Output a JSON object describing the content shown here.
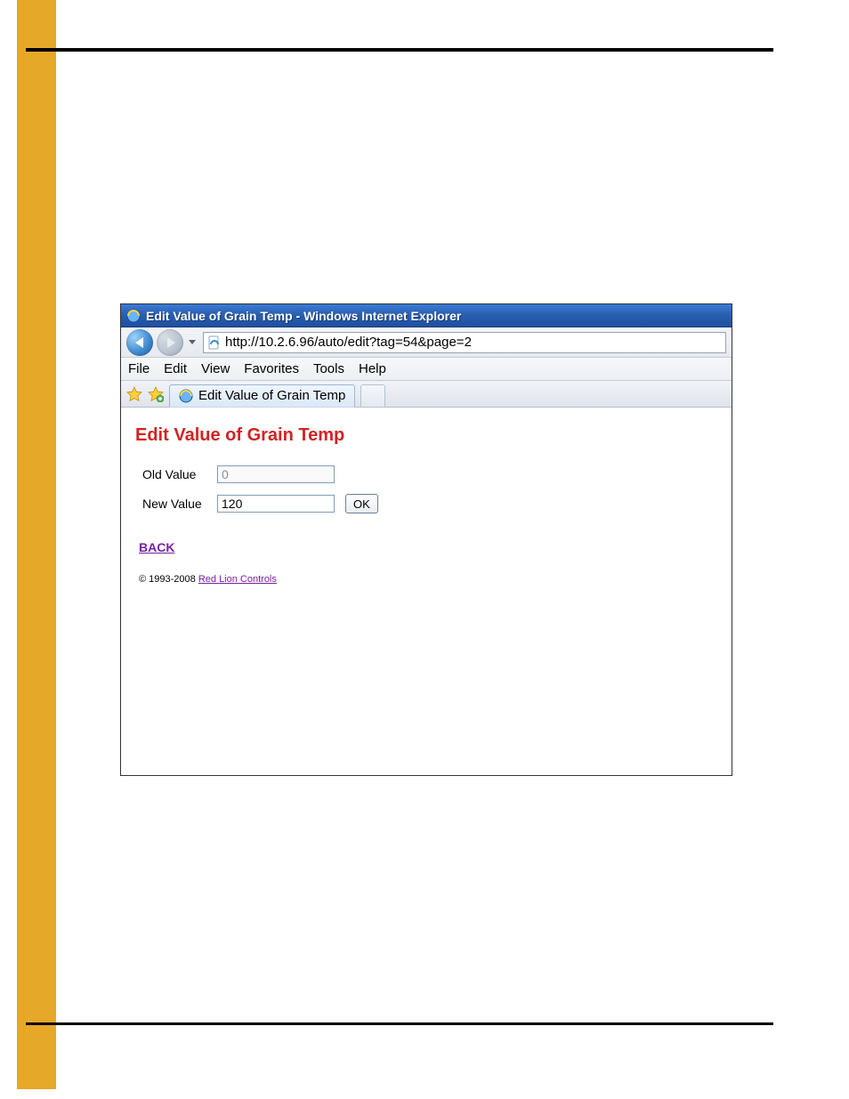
{
  "window_title": "Edit Value of Grain Temp - Windows Internet Explorer",
  "url": "http://10.2.6.96/auto/edit?tag=54&page=2",
  "menus": {
    "file": "File",
    "edit": "Edit",
    "view": "View",
    "favorites": "Favorites",
    "tools": "Tools",
    "help": "Help"
  },
  "tab_label": "Edit Value of Grain Temp",
  "page_heading": "Edit Value of Grain Temp",
  "form": {
    "old_label": "Old Value",
    "old_value": "0",
    "new_label": "New Value",
    "new_value": "120",
    "ok_label": "OK"
  },
  "back_label": "BACK",
  "copyright_prefix": "© 1993-2008 ",
  "copyright_link": "Red Lion Controls"
}
